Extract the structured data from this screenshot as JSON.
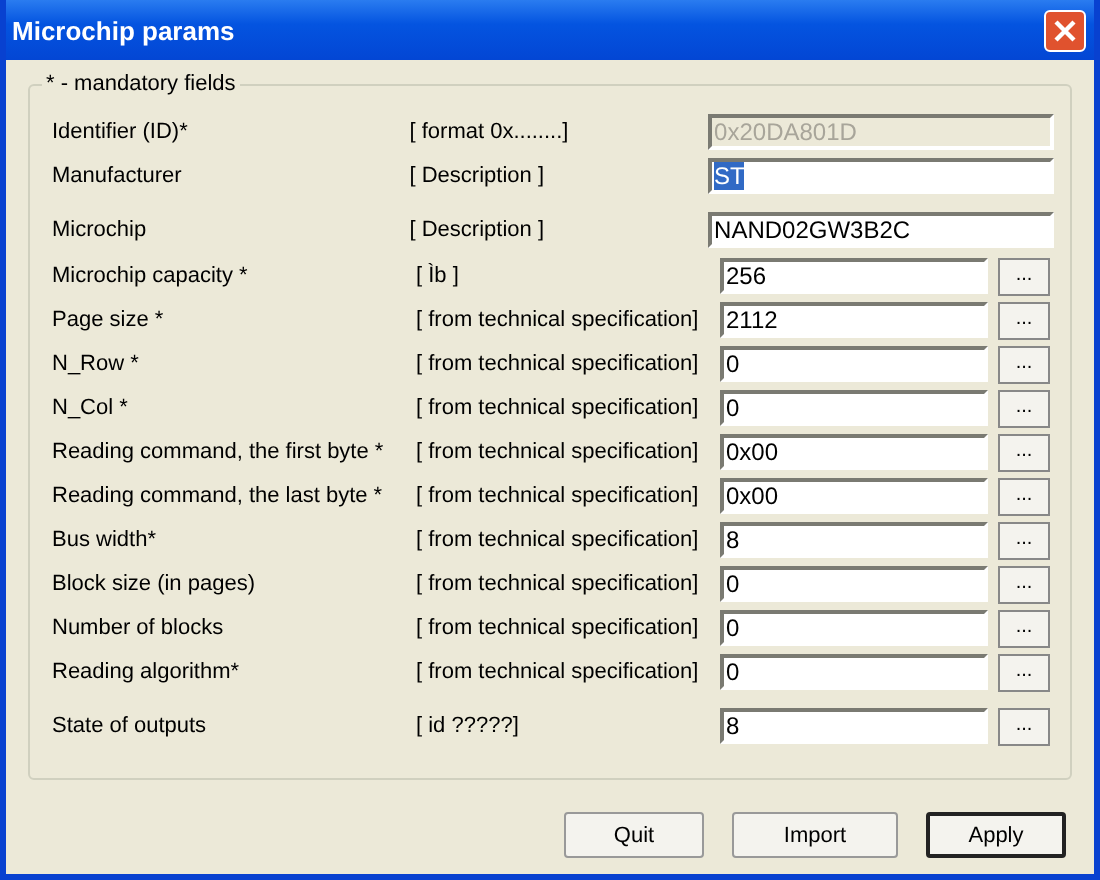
{
  "window": {
    "title": "Microchip params"
  },
  "group": {
    "legend": "* - mandatory fields"
  },
  "fields": [
    {
      "label": "Identifier (ID)*",
      "hint": "[ format 0x........]",
      "value": "0x20DA801D",
      "kind": "text",
      "disabled": true,
      "selected": false
    },
    {
      "label": "Manufacturer",
      "hint": "[ Description ]",
      "value": "ST",
      "kind": "text",
      "disabled": false,
      "selected": true
    },
    {
      "label": "Microchip",
      "hint": "[ Description ]",
      "value": "NAND02GW3B2C",
      "kind": "text",
      "disabled": false,
      "selected": false
    },
    {
      "label": "Microchip capacity *",
      "hint": "[ Ìb ]",
      "value": "256",
      "kind": "picker",
      "disabled": false,
      "selected": false
    },
    {
      "label": "Page size *",
      "hint": "[ from technical specification]",
      "value": "2112",
      "kind": "picker",
      "disabled": false,
      "selected": false
    },
    {
      "label": "N_Row *",
      "hint": "[ from technical specification]",
      "value": "0",
      "kind": "picker",
      "disabled": false,
      "selected": false
    },
    {
      "label": "N_Col *",
      "hint": "[ from technical specification]",
      "value": "0",
      "kind": "picker",
      "disabled": false,
      "selected": false
    },
    {
      "label": "Reading command, the first byte *",
      "hint": "[ from technical specification]",
      "value": "0x00",
      "kind": "picker",
      "disabled": false,
      "selected": false
    },
    {
      "label": "Reading command, the last byte *",
      "hint": "[ from technical specification]",
      "value": "0x00",
      "kind": "picker",
      "disabled": false,
      "selected": false
    },
    {
      "label": "Bus width*",
      "hint": "[ from technical specification]",
      "value": "8",
      "kind": "picker",
      "disabled": false,
      "selected": false
    },
    {
      "label": "Block size (in pages)",
      "hint": "[ from technical specification]",
      "value": "0",
      "kind": "picker",
      "disabled": false,
      "selected": false
    },
    {
      "label": "Number of blocks",
      "hint": "[ from technical specification]",
      "value": "0",
      "kind": "picker",
      "disabled": false,
      "selected": false
    },
    {
      "label": "Reading algorithm*",
      "hint": "[ from technical specification]",
      "value": "0",
      "kind": "picker",
      "disabled": false,
      "selected": false
    },
    {
      "label": "State of outputs",
      "hint": "[ id ?????]",
      "value": "8",
      "kind": "picker",
      "disabled": false,
      "selected": false
    }
  ],
  "picker_button": "...",
  "buttons": [
    {
      "label": "Quit",
      "default": false
    },
    {
      "label": "Import",
      "default": false
    },
    {
      "label": "Apply",
      "default": true
    }
  ]
}
